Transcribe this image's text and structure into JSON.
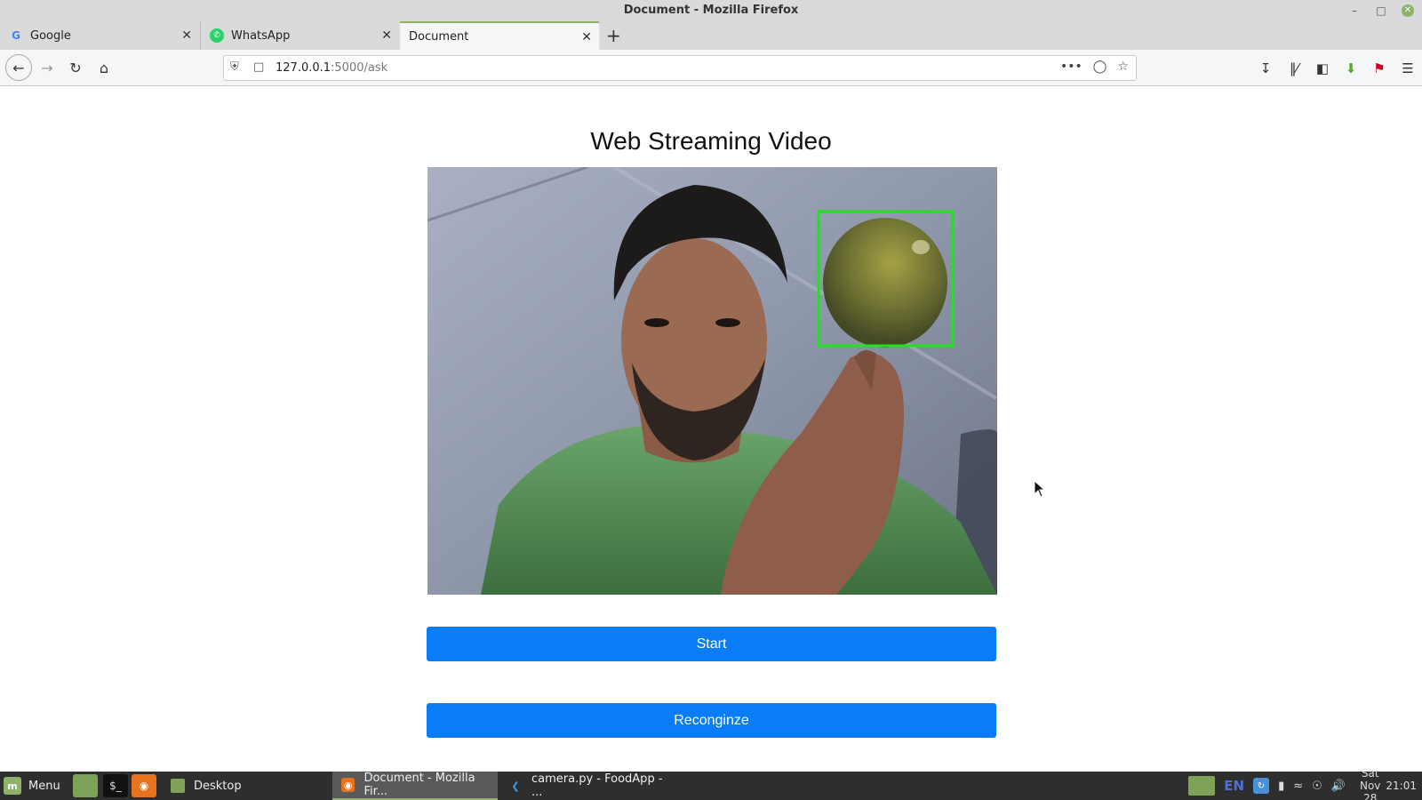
{
  "window": {
    "title": "Document - Mozilla Firefox"
  },
  "tabs": [
    {
      "label": "Google",
      "icon": "google-icon"
    },
    {
      "label": "WhatsApp",
      "icon": "whatsapp-icon"
    },
    {
      "label": "Document",
      "icon": "none",
      "active": true
    }
  ],
  "urlbar": {
    "host": "127.0.0.1",
    "path": ":5000/ask"
  },
  "page": {
    "title": "Web Streaming Video",
    "start_label": "Start",
    "recognize_label": "Reconginze"
  },
  "colors": {
    "button_bg": "#0a7cf5",
    "detect_box": "#1ee31e",
    "accent": "#8fb26b"
  },
  "taskbar": {
    "menu_label": "Menu",
    "windows": [
      {
        "label": "Desktop"
      },
      {
        "label": "Document - Mozilla Fir..."
      },
      {
        "label": "camera.py - FoodApp - ..."
      }
    ],
    "lang": "EN",
    "date": "Sat Nov 28",
    "time": "21:01"
  }
}
